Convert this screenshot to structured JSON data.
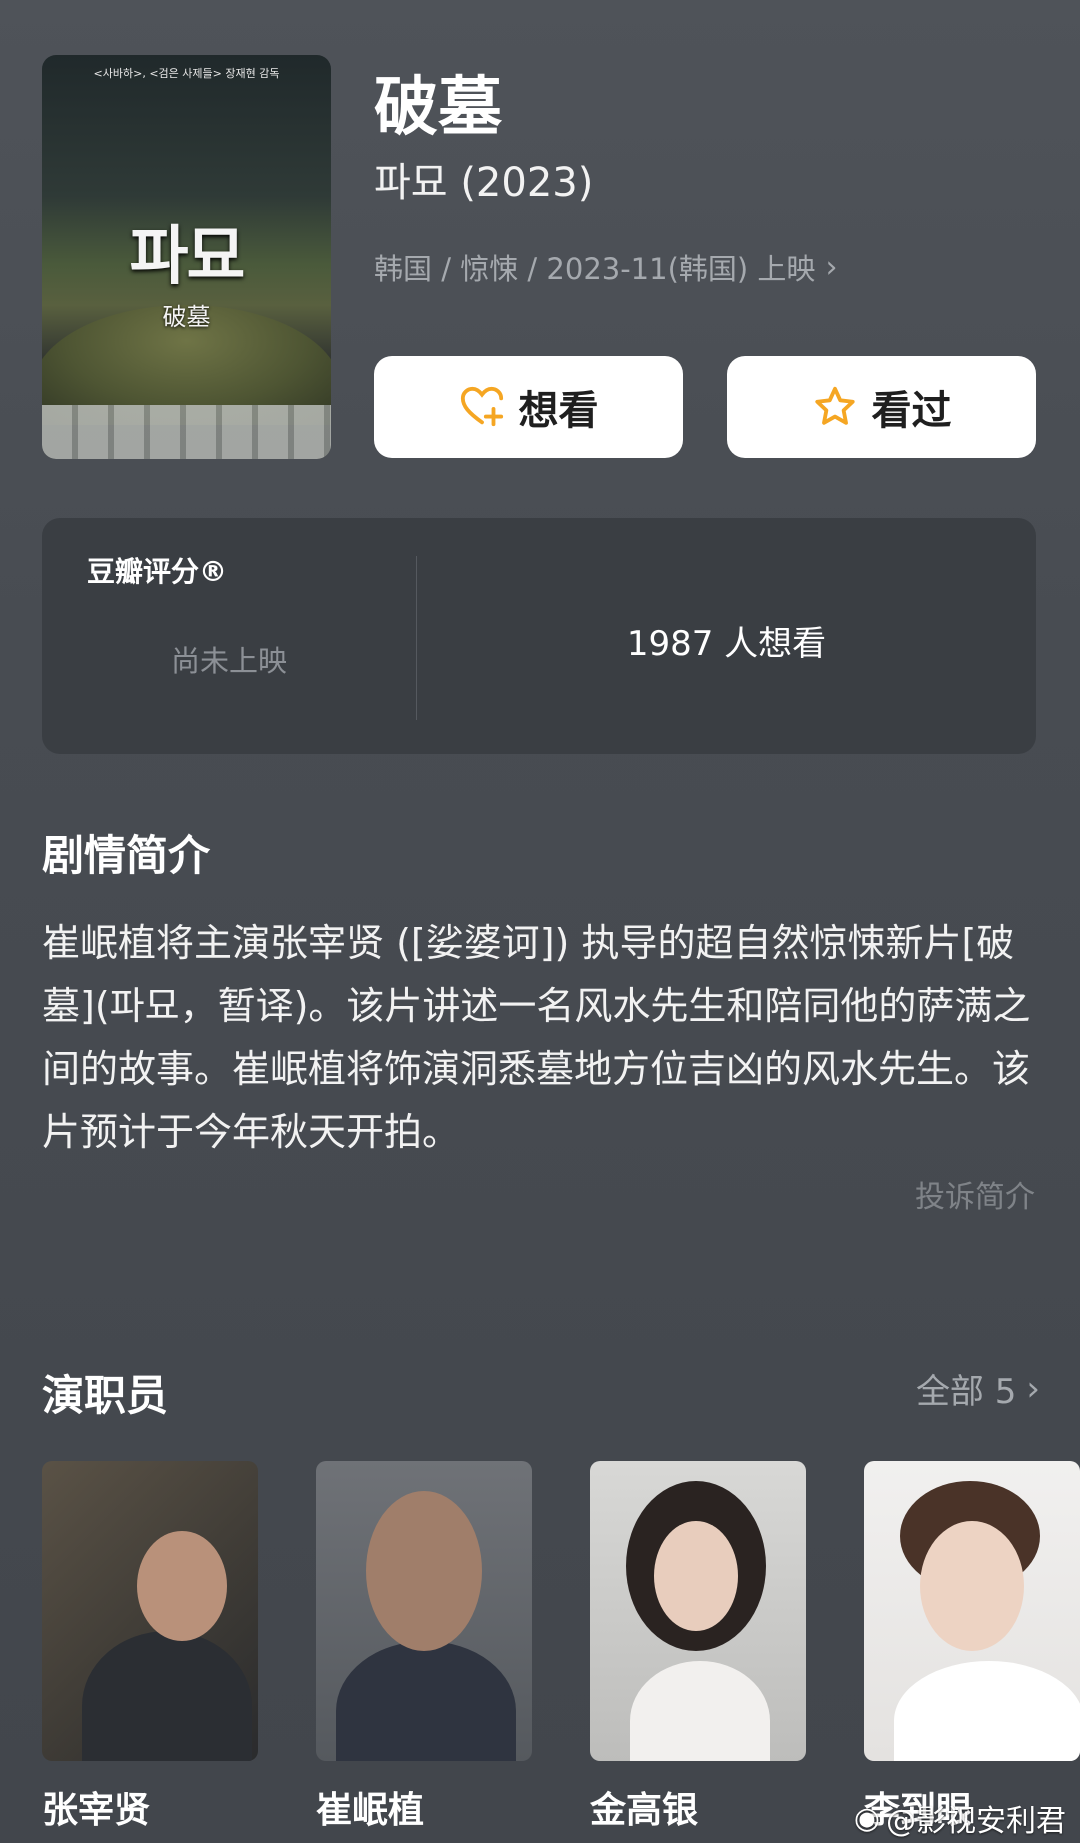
{
  "poster": {
    "credit": "<사바하>, <검은 사제들> 장재현 감독",
    "title_ko": "파묘",
    "title_zh": "破墓"
  },
  "movie": {
    "title": "破墓",
    "original_title": "파묘 (2023)",
    "meta": "韩国 / 惊悚 / 2023-11(韩国) 上映"
  },
  "actions": {
    "want_label": "想看",
    "seen_label": "看过",
    "icon_color": "#f5a623"
  },
  "rating": {
    "label": "豆瓣评分®",
    "status": "尚未上映",
    "wish_count": "1987 人想看"
  },
  "synopsis": {
    "heading": "剧情简介",
    "text": "崔岷植将主演张宰贤 ([娑婆诃]) 执导的超自然惊悚新片[破墓](파묘，暂译)。该片讲述一名风水先生和陪同他的萨满之间的故事。崔岷植将饰演洞悉墓地方位吉凶的风水先生。该片预计于今年秋天开拍。",
    "report": "投诉简介"
  },
  "cast": {
    "heading": "演职员",
    "all_label": "全部 5",
    "members": [
      {
        "name": "张宰贤"
      },
      {
        "name": "崔岷植"
      },
      {
        "name": "金高银"
      },
      {
        "name": "李到眼"
      }
    ]
  },
  "watermark": "@影视安利君"
}
